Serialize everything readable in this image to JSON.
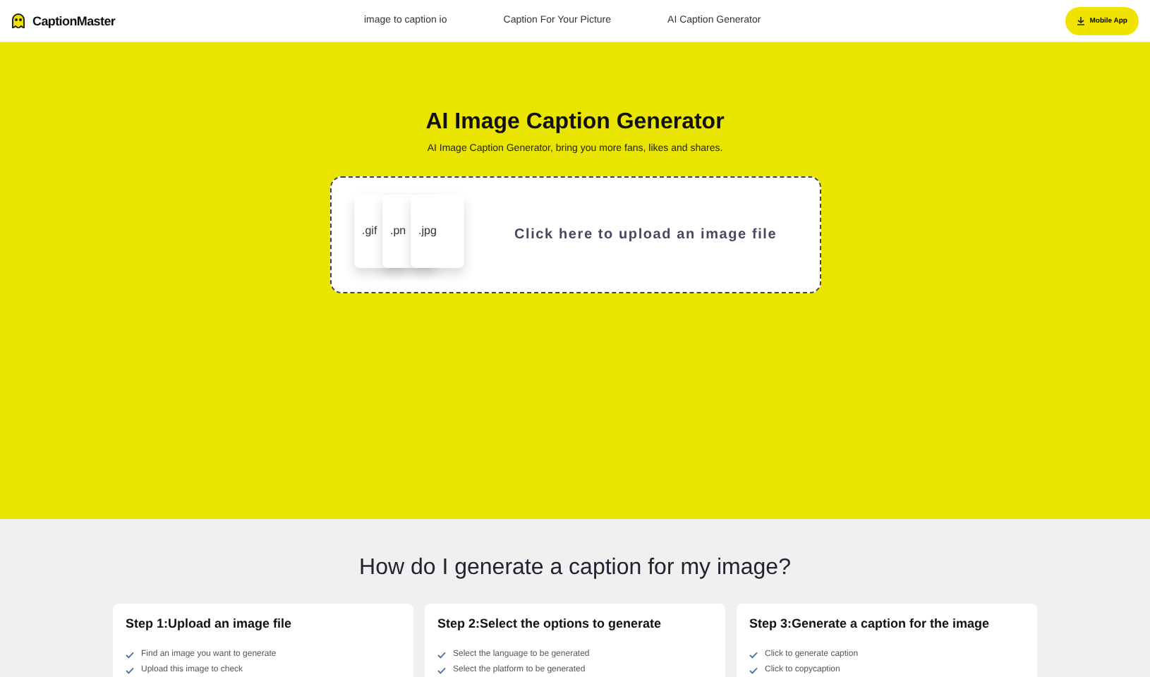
{
  "header": {
    "logo": "CaptionMaster",
    "nav": [
      "image to caption io",
      "Caption For Your Picture",
      "AI Caption Generator"
    ],
    "button": "Mobile App"
  },
  "hero": {
    "title": "AI Image Caption Generator",
    "subtitle": "AI Image Caption Generator, bring you more fans, likes and shares.",
    "upload": {
      "files": [
        ".gif",
        ".pn",
        ".jpg"
      ],
      "label": "Click here to upload an image file"
    }
  },
  "steps": {
    "title": "How do I generate a caption for my image?",
    "cards": [
      {
        "title": "Step 1:Upload an image file",
        "items": [
          "Find an image you want to generate",
          "Upload this image to check"
        ]
      },
      {
        "title": "Step 2:Select the options to generate",
        "items": [
          "Select the language to be generated",
          "Select the platform to be generated"
        ]
      },
      {
        "title": "Step 3:Generate a caption for the image",
        "items": [
          "Click to generate caption",
          "Click to copycaption"
        ]
      }
    ]
  }
}
